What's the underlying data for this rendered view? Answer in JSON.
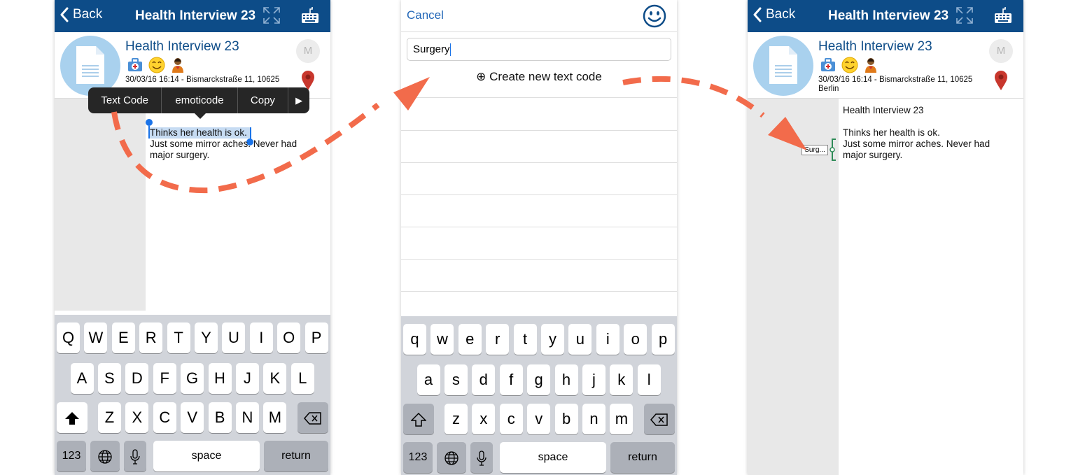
{
  "colors": {
    "navbar": "#0d4c88",
    "accent_link": "#2468b8",
    "arrow": "#f26b4b",
    "selection": "#c6dbf2",
    "code_marker": "#2e8b57"
  },
  "interview": {
    "back_label": "Back",
    "title": "Health Interview 23",
    "meta_line1": "30/03/16 16:14 - Bismarckstraße 11, 10625",
    "meta_line2": "Berlin",
    "avatar_initial": "M",
    "icons": [
      "doctor-bag-icon",
      "smiley-emoji-icon",
      "person-icon",
      "location-pin-icon",
      "expand-icon",
      "keyboard-icon"
    ]
  },
  "note": {
    "heading": "Health Interview 23",
    "line1": "Thinks her health is ok.",
    "line2": "Just some mirror aches. Never had",
    "line3": "major surgery."
  },
  "context_menu": {
    "items": [
      "Text Code",
      "emoticode",
      "Copy"
    ],
    "more": "▶"
  },
  "code_picker": {
    "cancel_label": "Cancel",
    "search_value": "Surgery",
    "create_label": "Create new text code",
    "create_icon": "⊕"
  },
  "code_tag": {
    "label": "Surg..."
  },
  "keyboard_upper": {
    "row1": [
      "Q",
      "W",
      "E",
      "R",
      "T",
      "Y",
      "U",
      "I",
      "O",
      "P"
    ],
    "row2": [
      "A",
      "S",
      "D",
      "F",
      "G",
      "H",
      "J",
      "K",
      "L"
    ],
    "row3": [
      "Z",
      "X",
      "C",
      "V",
      "B",
      "N",
      "M"
    ]
  },
  "keyboard_lower": {
    "row1": [
      "q",
      "w",
      "e",
      "r",
      "t",
      "y",
      "u",
      "i",
      "o",
      "p"
    ],
    "row2": [
      "a",
      "s",
      "d",
      "f",
      "g",
      "h",
      "j",
      "k",
      "l"
    ],
    "row3": [
      "z",
      "x",
      "c",
      "v",
      "b",
      "n",
      "m"
    ]
  },
  "keyboard_bottom": {
    "numbers": "123",
    "space": "space",
    "return": "return"
  }
}
